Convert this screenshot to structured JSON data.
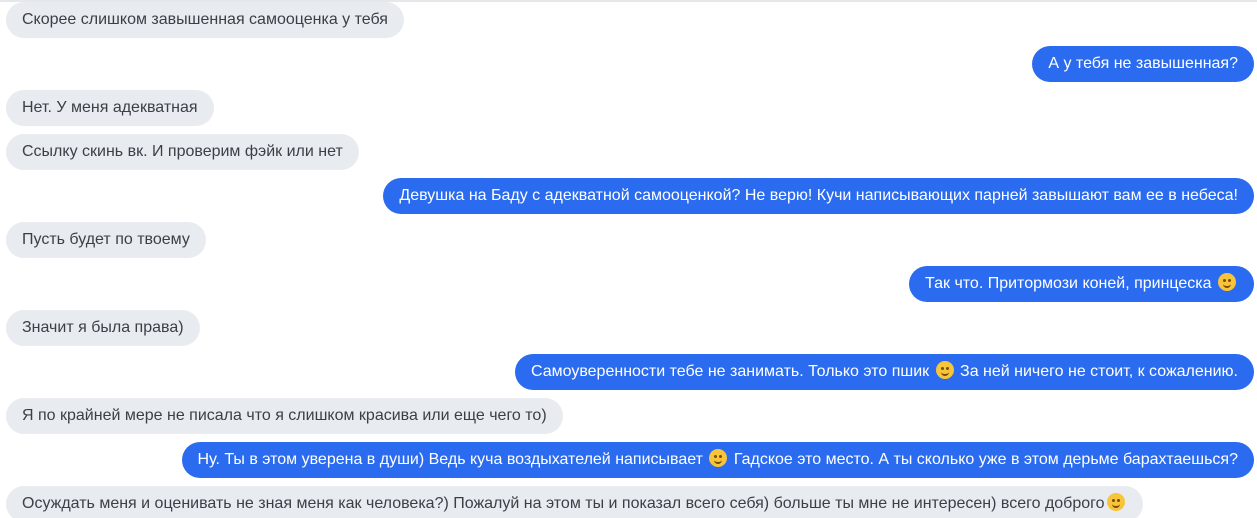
{
  "messages": [
    {
      "direction": "incoming",
      "segments": [
        {
          "text": "Скорее слишком завышенная самооценка у тебя"
        }
      ]
    },
    {
      "direction": "outgoing",
      "segments": [
        {
          "text": "А у тебя не завышенная?"
        }
      ]
    },
    {
      "direction": "incoming",
      "segments": [
        {
          "text": "Нет. У меня адекватная"
        }
      ]
    },
    {
      "direction": "incoming",
      "segments": [
        {
          "text": "Ссылку скинь вк. И проверим фэйк или нет"
        }
      ]
    },
    {
      "direction": "outgoing",
      "segments": [
        {
          "text": "Девушка на Баду с адекватной самооценкой? Не верю! Кучи написывающих парней завышают вам ее в небеса!"
        }
      ]
    },
    {
      "direction": "incoming",
      "segments": [
        {
          "text": "Пусть будет по твоему"
        }
      ]
    },
    {
      "direction": "outgoing",
      "segments": [
        {
          "text": "Так что. Притормози коней, принцеска "
        },
        {
          "emoji": "smile-emoji"
        }
      ]
    },
    {
      "direction": "incoming",
      "segments": [
        {
          "text": "Значит я была права)"
        }
      ]
    },
    {
      "direction": "outgoing",
      "segments": [
        {
          "text": "Самоуверенности тебе не занимать. Только это пшик "
        },
        {
          "emoji": "smile-emoji"
        },
        {
          "text": "  За ней ничего не стоит, к сожалению."
        }
      ]
    },
    {
      "direction": "incoming",
      "segments": [
        {
          "text": "Я по крайней мере не писала что я слишком красива или еще чего то)"
        }
      ]
    },
    {
      "direction": "outgoing",
      "segments": [
        {
          "text": "Ну. Ты в этом уверена в души) Ведь куча воздыхателей написывает "
        },
        {
          "emoji": "smile-emoji"
        },
        {
          "text": " Гадское это место. А ты сколько уже в этом дерьме барахтаешься?"
        }
      ]
    },
    {
      "direction": "incoming",
      "segments": [
        {
          "text": "Осуждать меня и оценивать не зная меня как человека?) Пожалуй на этом ты и показал всего себя) больше ты мне не интересен) всего доброго"
        },
        {
          "emoji": "wink-emoji"
        }
      ]
    }
  ],
  "colors": {
    "incoming_bg": "#e8ebf0",
    "incoming_text": "#3b3f47",
    "outgoing_bg": "#2a6bf0",
    "outgoing_text": "#ffffff",
    "emoji": "#f7c43a"
  }
}
